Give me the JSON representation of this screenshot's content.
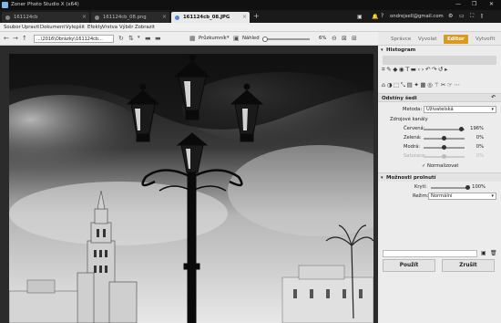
{
  "window": {
    "title": "Zoner Photo Studio X (x64)",
    "controls": [
      "—",
      "❐",
      "✕"
    ]
  },
  "tabs": [
    {
      "label": "161124cb",
      "active": false
    },
    {
      "label": "161124cb_08.png",
      "active": false
    },
    {
      "label": "161124cb_08.JPG",
      "active": true
    }
  ],
  "user": {
    "email": "ondrejsell@gmail.com"
  },
  "menu": [
    "Soubor",
    "Upravit",
    "Dokument",
    "Vylepšit",
    "Efekty",
    "Vrstva",
    "Výběr",
    "Zobrazit"
  ],
  "toolbar": {
    "path": "...\\2016\\Obrázky\\161124cb...",
    "compare_label": "Průzkumník",
    "preview_label": "Náhled",
    "zoom": "6%"
  },
  "modules": [
    {
      "label": "Správce",
      "active": false
    },
    {
      "label": "Vyvolat",
      "active": false
    },
    {
      "label": "Editor",
      "active": true
    },
    {
      "label": "Vytvořit",
      "active": false
    }
  ],
  "panel": {
    "histogram_label": "Histogram",
    "section_label": "Odstíny šedi",
    "method_label": "Metoda:",
    "method_value": "Uživatelská",
    "sources_label": "Zdrojové kanály",
    "channels": [
      {
        "label": "Červená:",
        "value": "196%",
        "fraction": 0.93,
        "enabled": true
      },
      {
        "label": "Zelená:",
        "value": "0%",
        "fraction": 0.5,
        "enabled": true
      },
      {
        "label": "Modrá:",
        "value": "0%",
        "fraction": 0.5,
        "enabled": true
      },
      {
        "label": "Saturace:",
        "value": "0%",
        "fraction": 0.5,
        "enabled": false
      }
    ],
    "normalize_label": "Normalizovat",
    "blend_section_label": "Možnosti prolnutí",
    "opacity_label": "Krytí:",
    "opacity_value": "100%",
    "opacity_fraction": 1.0,
    "mode_label": "Režim:",
    "mode_value": "Normální",
    "apply_label": "Použít",
    "cancel_label": "Zrušit"
  },
  "colors": {
    "accent": "#d99a1e",
    "titlebar": "#101010",
    "panel": "#ececec"
  }
}
